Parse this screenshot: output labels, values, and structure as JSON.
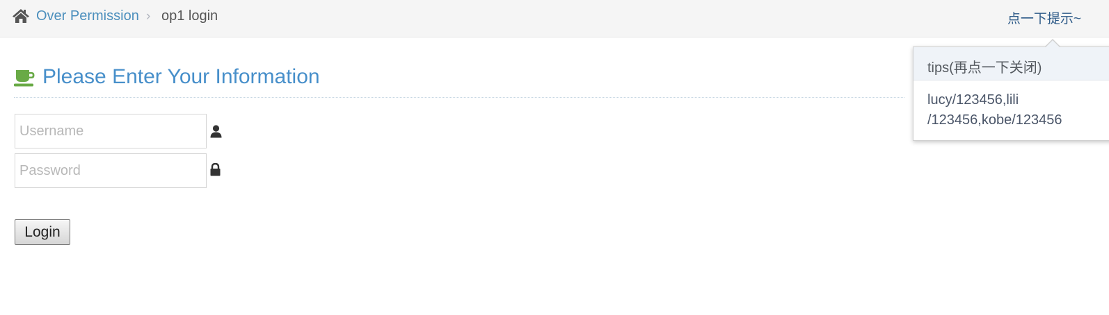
{
  "breadcrumbs": {
    "home_icon": "home-icon",
    "link_label": "Over Permission",
    "separator": "›",
    "active_label": "op1 login"
  },
  "tips_toggle": {
    "label": "点一下提示~"
  },
  "tips_popover": {
    "title": "tips(再点一下关闭)",
    "content_lines": [
      "lucy/123456,lili",
      "/123456,kobe/123456"
    ]
  },
  "page_header": {
    "icon": "coffee-icon",
    "title": "Please Enter Your Information"
  },
  "form": {
    "username": {
      "placeholder": "Username",
      "value": "",
      "icon": "user-icon"
    },
    "password": {
      "placeholder": "Password",
      "value": "",
      "icon": "lock-icon"
    },
    "login_button_label": "Login"
  },
  "colors": {
    "link": "#4c8fbd",
    "title": "#478fca",
    "coffee_icon": "#69aa46",
    "breadcrumb_bg": "#f5f5f5",
    "popover_title_bg": "#eff3f8"
  }
}
